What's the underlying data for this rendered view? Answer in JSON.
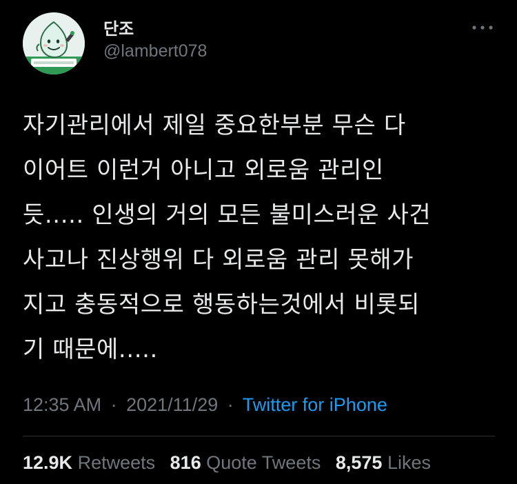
{
  "author": {
    "display_name": "단조",
    "handle": "@lambert078",
    "avatar_icon": "mascot-avatar-icon",
    "avatar_sign_text": "손만두전문점"
  },
  "tweet": {
    "lines": [
      "자기관리에서 제일 중요한부분 무슨 다",
      "이어트 이런거 아니고 외로움 관리인",
      "듯..... 인생의 거의 모든 불미스러운 사건",
      "사고나 진상행위 다 외로움 관리 못해가",
      "지고 충동적으로 행동하는것에서 비롯되",
      "기 때문에....."
    ],
    "time": "12:35 AM",
    "separator": "·",
    "date": "2021/11/29",
    "source": "Twitter for iPhone"
  },
  "stats": {
    "retweets_count": "12.9K",
    "retweets_label": "Retweets",
    "quotes_count": "816",
    "quotes_label": "Quote Tweets",
    "likes_count": "8,575",
    "likes_label": "Likes"
  },
  "colors": {
    "background": "#000000",
    "primary_text": "#e7e9ea",
    "secondary_text": "#71767b",
    "link": "#1d9bf0",
    "divider": "#2f3336",
    "avatar_green": "#2f9a55"
  },
  "icons": {
    "more": "more-horizontal-icon"
  }
}
